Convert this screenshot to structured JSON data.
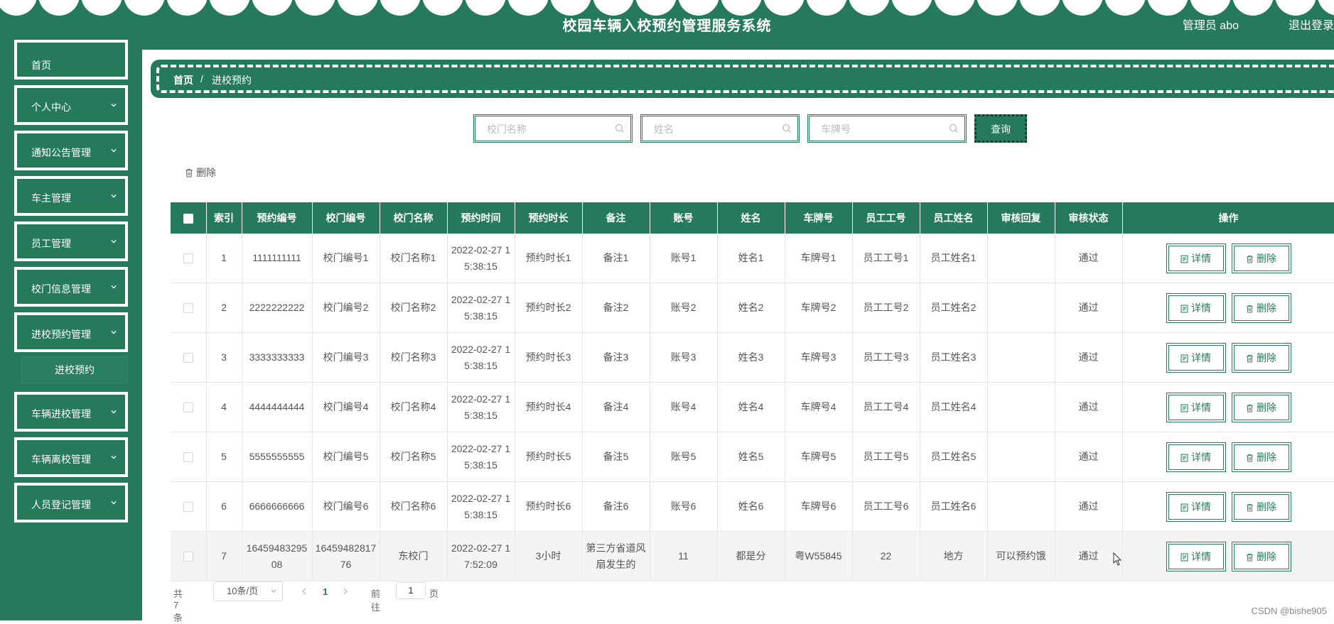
{
  "header": {
    "title": "校园车辆入校预约管理服务系统",
    "user": "管理员 abo",
    "logout": "退出登录"
  },
  "sidebar": {
    "items": [
      {
        "label": "首页"
      },
      {
        "label": "个人中心"
      },
      {
        "label": "通知公告管理"
      },
      {
        "label": "车主管理"
      },
      {
        "label": "员工管理"
      },
      {
        "label": "校门信息管理"
      },
      {
        "label": "进校预约管理"
      },
      {
        "label": "车辆进校管理"
      },
      {
        "label": "车辆离校管理"
      },
      {
        "label": "人员登记管理"
      }
    ],
    "submenu_active": "进校预约"
  },
  "breadcrumb": {
    "home": "首页",
    "separator": "/",
    "current": "进校预约"
  },
  "search": {
    "gate_name_placeholder": "校门名称",
    "name_placeholder": "姓名",
    "plate_placeholder": "车牌号",
    "query_label": "查询"
  },
  "toolbar": {
    "delete_label": "删除"
  },
  "table": {
    "columns": [
      "索引",
      "预约编号",
      "校门编号",
      "校门名称",
      "预约时间",
      "预约时长",
      "备注",
      "账号",
      "姓名",
      "车牌号",
      "员工工号",
      "员工姓名",
      "审核回复",
      "审核状态",
      "操作"
    ],
    "rows": [
      {
        "index": "1",
        "booking_no": "1111111111",
        "gate_no": "校门编号1",
        "gate_name": "校门名称1",
        "time": "2022-02-27 15:38:15",
        "duration": "预约时长1",
        "remark": "备注1",
        "account": "账号1",
        "name": "姓名1",
        "plate": "车牌号1",
        "staff_no": "员工工号1",
        "staff_name": "员工姓名1",
        "reply": "",
        "status": "通过"
      },
      {
        "index": "2",
        "booking_no": "2222222222",
        "gate_no": "校门编号2",
        "gate_name": "校门名称2",
        "time": "2022-02-27 15:38:15",
        "duration": "预约时长2",
        "remark": "备注2",
        "account": "账号2",
        "name": "姓名2",
        "plate": "车牌号2",
        "staff_no": "员工工号2",
        "staff_name": "员工姓名2",
        "reply": "",
        "status": "通过"
      },
      {
        "index": "3",
        "booking_no": "3333333333",
        "gate_no": "校门编号3",
        "gate_name": "校门名称3",
        "time": "2022-02-27 15:38:15",
        "duration": "预约时长3",
        "remark": "备注3",
        "account": "账号3",
        "name": "姓名3",
        "plate": "车牌号3",
        "staff_no": "员工工号3",
        "staff_name": "员工姓名3",
        "reply": "",
        "status": "通过"
      },
      {
        "index": "4",
        "booking_no": "4444444444",
        "gate_no": "校门编号4",
        "gate_name": "校门名称4",
        "time": "2022-02-27 15:38:15",
        "duration": "预约时长4",
        "remark": "备注4",
        "account": "账号4",
        "name": "姓名4",
        "plate": "车牌号4",
        "staff_no": "员工工号4",
        "staff_name": "员工姓名4",
        "reply": "",
        "status": "通过"
      },
      {
        "index": "5",
        "booking_no": "5555555555",
        "gate_no": "校门编号5",
        "gate_name": "校门名称5",
        "time": "2022-02-27 15:38:15",
        "duration": "预约时长5",
        "remark": "备注5",
        "account": "账号5",
        "name": "姓名5",
        "plate": "车牌号5",
        "staff_no": "员工工号5",
        "staff_name": "员工姓名5",
        "reply": "",
        "status": "通过"
      },
      {
        "index": "6",
        "booking_no": "6666666666",
        "gate_no": "校门编号6",
        "gate_name": "校门名称6",
        "time": "2022-02-27 15:38:15",
        "duration": "预约时长6",
        "remark": "备注6",
        "account": "账号6",
        "name": "姓名6",
        "plate": "车牌号6",
        "staff_no": "员工工号6",
        "staff_name": "员工姓名6",
        "reply": "",
        "status": "通过"
      },
      {
        "index": "7",
        "booking_no": "1645948329508",
        "gate_no": "1645948281776",
        "gate_name": "东校门",
        "time": "2022-02-27 17:52:09",
        "duration": "3小时",
        "remark": "第三方省道风扇发生的",
        "account": "11",
        "name": "都是分",
        "plate": "粤W55845",
        "staff_no": "22",
        "staff_name": "地方",
        "reply": "可以预约饿",
        "status": "通过"
      }
    ],
    "detail_label": "详情",
    "delete_label": "删除"
  },
  "pagination": {
    "total": "共 7 条",
    "page_size": "10条/页",
    "current_page": "1",
    "goto_prefix": "前往",
    "goto_value": "1",
    "goto_suffix": "页"
  },
  "watermark": "CSDN @bishe905",
  "colors": {
    "primary": "#267a5c"
  }
}
